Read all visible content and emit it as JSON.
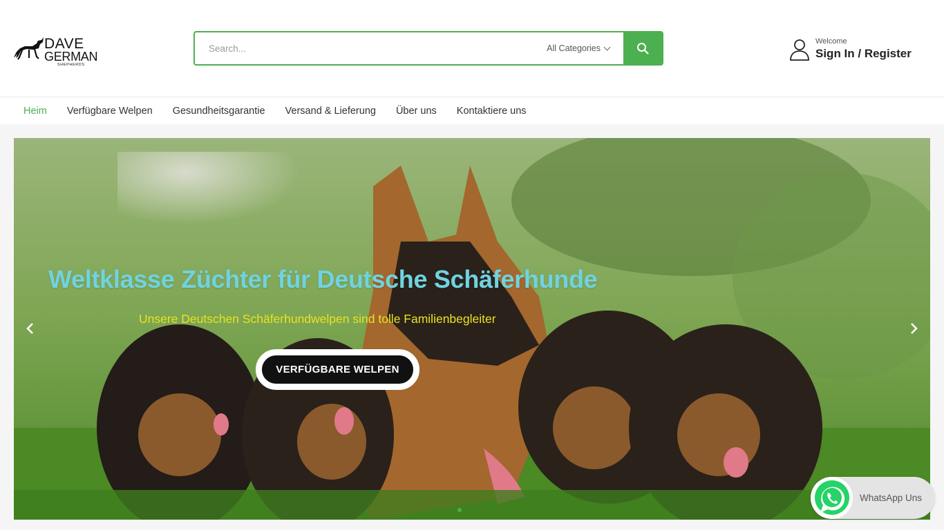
{
  "header": {
    "logo": {
      "line1": "DAVE",
      "line2": "GERMAN",
      "line3": "SHEPHERDS"
    },
    "search": {
      "placeholder": "Search...",
      "category": "All Categories"
    },
    "account": {
      "welcome": "Welcome",
      "sign_in": "Sign In / Register"
    }
  },
  "nav": {
    "items": [
      {
        "label": "Heim",
        "active": true
      },
      {
        "label": "Verfügbare Welpen"
      },
      {
        "label": "Gesundheitsgarantie"
      },
      {
        "label": "Versand & Lieferung"
      },
      {
        "label": "Über uns"
      },
      {
        "label": "Kontaktiere uns"
      }
    ]
  },
  "hero": {
    "title": "Weltklasse Züchter für Deutsche Schäferhunde",
    "subtitle": "Unsere Deutschen Schäferhundwelpen sind tolle Familienbegleiter",
    "button": "VERFÜGBARE WELPEN"
  },
  "whatsapp": {
    "label": "WhatsApp Uns"
  },
  "colors": {
    "accent": "#4caf50",
    "title": "#6fd3e0",
    "subtitle": "#e8e221"
  },
  "icons": [
    "dog-logo-icon",
    "search-icon",
    "chevron-down-icon",
    "user-icon",
    "chevron-left-icon",
    "chevron-right-icon",
    "whatsapp-icon"
  ]
}
